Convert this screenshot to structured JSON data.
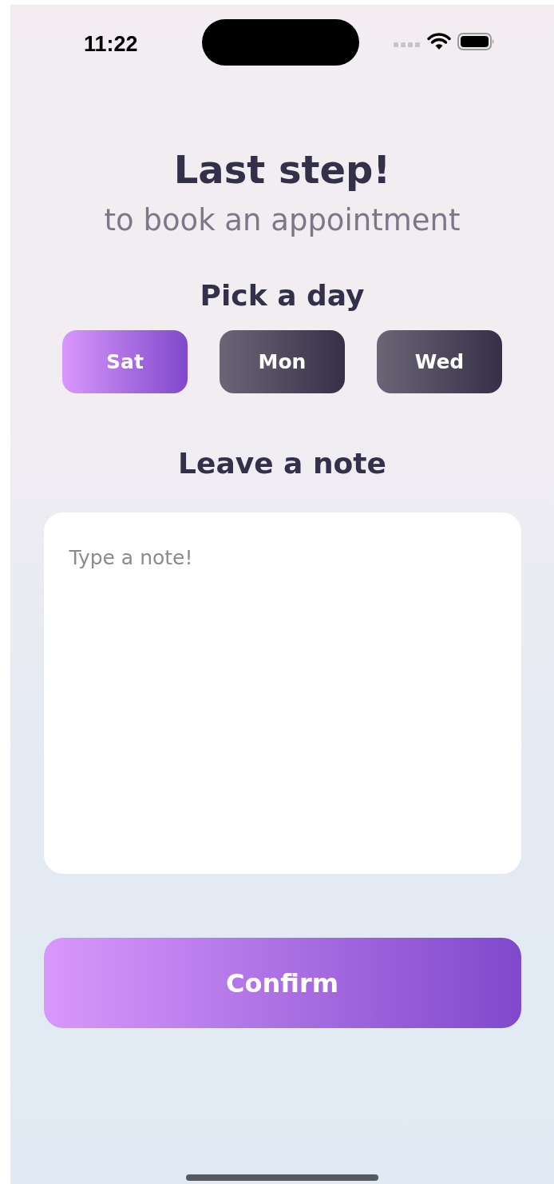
{
  "status_bar": {
    "time": "11:22"
  },
  "title": "Last step!",
  "subtitle": "to book an appointment",
  "day_section": {
    "heading": "Pick a day",
    "days": [
      {
        "label": "Sat",
        "selected": true
      },
      {
        "label": "Mon",
        "selected": false
      },
      {
        "label": "Wed",
        "selected": false
      }
    ]
  },
  "note_section": {
    "heading": "Leave a note",
    "placeholder": "Type a note!"
  },
  "confirm_button": "Confirm"
}
